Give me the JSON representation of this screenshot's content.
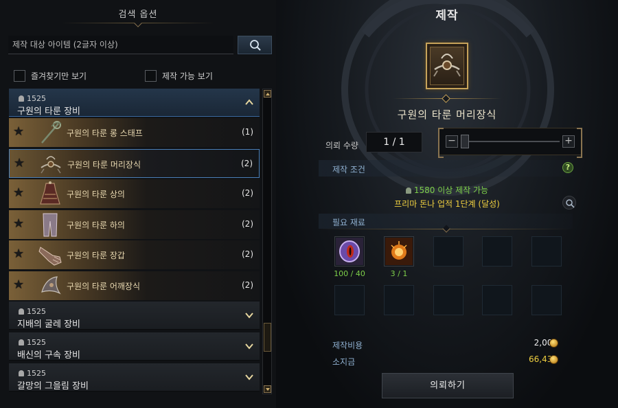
{
  "search_options": {
    "title": "검색 옵션",
    "search_placeholder": "제작 대상 아이템 (2글자 이상)",
    "favorites_only_label": "즐겨찾기만 보기",
    "craftable_only_label": "제작 가능 보기"
  },
  "categories": [
    {
      "level": "1525",
      "name": "구원의 타룬 장비",
      "expanded": true,
      "items": [
        {
          "name": "구원의 타룬 롱 스태프",
          "count": "(1)",
          "icon": "staff-icon"
        },
        {
          "name": "구원의 타룬 머리장식",
          "count": "(2)",
          "icon": "headpiece-icon"
        },
        {
          "name": "구원의 타룬 상의",
          "count": "(2)",
          "icon": "top-armor-icon"
        },
        {
          "name": "구원의 타룬 하의",
          "count": "(2)",
          "icon": "bottom-armor-icon"
        },
        {
          "name": "구원의 타룬 장갑",
          "count": "(2)",
          "icon": "gloves-icon"
        },
        {
          "name": "구원의 타룬 어깨장식",
          "count": "(2)",
          "icon": "shoulder-icon"
        }
      ]
    },
    {
      "level": "1525",
      "name": "지배의 굴레 장비",
      "expanded": false
    },
    {
      "level": "1525",
      "name": "배신의 구속 장비",
      "expanded": false
    },
    {
      "level": "1525",
      "name": "갈망의 그을림 장비",
      "expanded": false
    }
  ],
  "selected_item_index": 1,
  "craft": {
    "title": "제작",
    "item_name": "구원의 타룬 머리장식",
    "quantity_label": "의뢰 수량",
    "quantity_value": "1 / 1",
    "slider_level": 0,
    "conditions_label": "제작 조건",
    "condition_level": "1580 이상 제작 가능",
    "condition_quest": "프리마 돈나 업적 1단계 (달성)",
    "materials_label": "필요 재료",
    "materials": [
      {
        "icon": "purple-eye-orb-icon",
        "count": "100 / 40"
      },
      {
        "icon": "fire-stone-icon",
        "count": "3 / 1"
      }
    ],
    "cost_label": "제작비용",
    "cost_value": "2,000",
    "gold_label": "소지금",
    "gold_value": "66,433",
    "request_button": "의뢰하기"
  },
  "colors": {
    "condition_ok": "#7ed04a",
    "quest_text": "#f0d040",
    "selected_border": "#4a7fb8",
    "gold_text": "#f0d040"
  }
}
